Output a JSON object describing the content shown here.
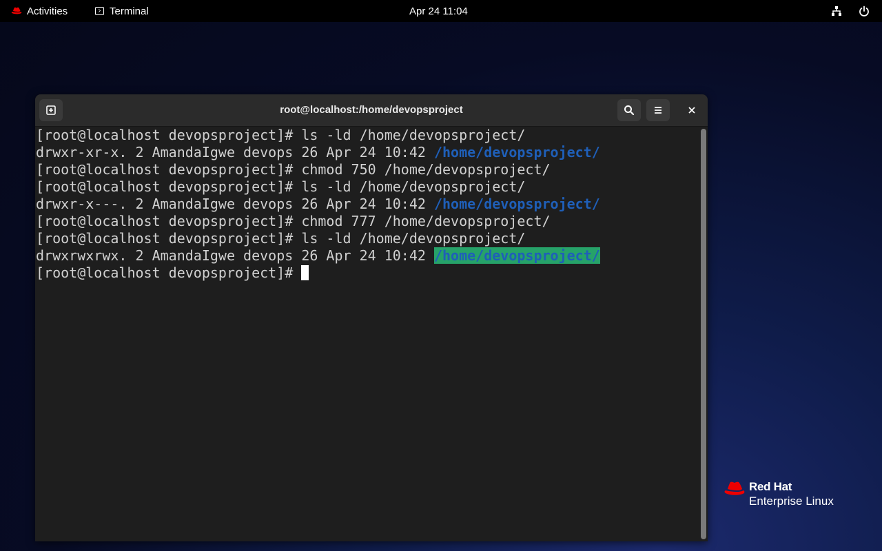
{
  "topbar": {
    "activities_label": "Activities",
    "app_name": "Terminal",
    "clock": "Apr 24  11:04"
  },
  "window": {
    "title": "root@localhost:/home/devopsproject"
  },
  "terminal": {
    "lines": [
      {
        "text": "[root@localhost devopsproject]# ls -ld /home/devopsproject/"
      },
      {
        "prefix": "drwxr-xr-x. 2 AmandaIgwe devops 26 Apr 24 10:42 ",
        "path": "/home/devopsproject/"
      },
      {
        "text": "[root@localhost devopsproject]# chmod 750 /home/devopsproject/"
      },
      {
        "text": "[root@localhost devopsproject]# ls -ld /home/devopsproject/"
      },
      {
        "prefix": "drwxr-x---. 2 AmandaIgwe devops 26 Apr 24 10:42 ",
        "path": "/home/devopsproject/"
      },
      {
        "text": "[root@localhost devopsproject]# chmod 777 /home/devopsproject/"
      },
      {
        "text": "[root@localhost devopsproject]# ls -ld /home/devopsproject/"
      },
      {
        "prefix": "drwxrwxrwx. 2 AmandaIgwe devops 26 Apr 24 10:42 ",
        "path": "/home/devopsproject/"
      },
      {
        "text": "[root@localhost devopsproject]# "
      }
    ]
  },
  "branding": {
    "line1": "Red Hat",
    "line2": "Enterprise Linux"
  },
  "colors": {
    "dir_blue": "#1f5fb8",
    "other_writable_bg": "#26a269",
    "redhat_red": "#ee0000"
  },
  "icons": {
    "new_tab": "new-tab-icon",
    "search": "search-icon",
    "menu": "hamburger-menu-icon",
    "close": "close-icon",
    "network": "network-icon",
    "power": "power-icon"
  }
}
